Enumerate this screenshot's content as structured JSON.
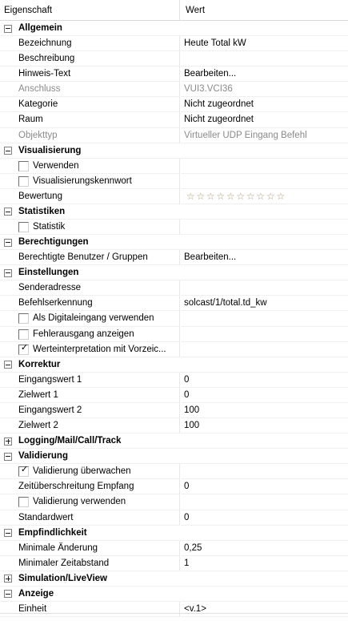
{
  "header": {
    "property": "Eigenschaft",
    "value": "Wert"
  },
  "categories": [
    {
      "label": "Allgemein",
      "expanded": true,
      "rows": [
        {
          "kind": "prop",
          "name": "Bezeichnung",
          "value": "Heute Total kW"
        },
        {
          "kind": "prop",
          "name": "Beschreibung",
          "value": ""
        },
        {
          "kind": "prop",
          "name": "Hinweis-Text",
          "value": "Bearbeiten..."
        },
        {
          "kind": "prop",
          "name": "Anschluss",
          "value": "VUI3.VCI36",
          "disabled": true
        },
        {
          "kind": "prop",
          "name": "Kategorie",
          "value": "Nicht zugeordnet"
        },
        {
          "kind": "prop",
          "name": "Raum",
          "value": "Nicht zugeordnet"
        },
        {
          "kind": "prop",
          "name": "Objekttyp",
          "value": "Virtueller UDP Eingang Befehl",
          "disabled": true
        }
      ]
    },
    {
      "label": "Visualisierung",
      "expanded": true,
      "rows": [
        {
          "kind": "check",
          "name": "Verwenden",
          "checked": false
        },
        {
          "kind": "check",
          "name": "Visualisierungskennwort",
          "checked": false
        },
        {
          "kind": "stars",
          "name": "Bewertung",
          "rating": 0,
          "max": 10,
          "icon": "star-outline-icon"
        }
      ]
    },
    {
      "label": "Statistiken",
      "expanded": true,
      "rows": [
        {
          "kind": "check",
          "name": "Statistik",
          "checked": false
        }
      ]
    },
    {
      "label": "Berechtigungen",
      "expanded": true,
      "rows": [
        {
          "kind": "prop",
          "name": "Berechtigte Benutzer / Gruppen",
          "value": "Bearbeiten..."
        }
      ]
    },
    {
      "label": "Einstellungen",
      "expanded": true,
      "rows": [
        {
          "kind": "prop",
          "name": "Senderadresse",
          "value": ""
        },
        {
          "kind": "prop",
          "name": "Befehlserkennung",
          "value": "solcast/1/total.td_kw"
        },
        {
          "kind": "check",
          "name": "Als Digitaleingang verwenden",
          "checked": false
        },
        {
          "kind": "check",
          "name": "Fehlerausgang anzeigen",
          "checked": false
        },
        {
          "kind": "check",
          "name": "Werteinterpretation mit Vorzeic...",
          "checked": true
        }
      ]
    },
    {
      "label": "Korrektur",
      "expanded": true,
      "rows": [
        {
          "kind": "prop",
          "name": "Eingangswert 1",
          "value": "0"
        },
        {
          "kind": "prop",
          "name": "Zielwert 1",
          "value": "0"
        },
        {
          "kind": "prop",
          "name": "Eingangswert 2",
          "value": "100"
        },
        {
          "kind": "prop",
          "name": "Zielwert 2",
          "value": "100"
        }
      ]
    },
    {
      "label": "Logging/Mail/Call/Track",
      "expanded": false,
      "rows": []
    },
    {
      "label": "Validierung",
      "expanded": true,
      "rows": [
        {
          "kind": "check",
          "name": "Validierung überwachen",
          "checked": true
        },
        {
          "kind": "prop",
          "name": "Zeitüberschreitung Empfang",
          "value": "0"
        },
        {
          "kind": "check",
          "name": "Validierung verwenden",
          "checked": false
        },
        {
          "kind": "prop",
          "name": "Standardwert",
          "value": "0"
        }
      ]
    },
    {
      "label": "Empfindlichkeit",
      "expanded": true,
      "rows": [
        {
          "kind": "prop",
          "name": "Minimale Änderung",
          "value": "0,25"
        },
        {
          "kind": "prop",
          "name": "Minimaler Zeitabstand",
          "value": "1"
        }
      ]
    },
    {
      "label": "Simulation/LiveView",
      "expanded": false,
      "rows": []
    },
    {
      "label": "Anzeige",
      "expanded": true,
      "rows": [
        {
          "kind": "prop",
          "name": "Einheit",
          "value": "<v.1>"
        }
      ]
    }
  ]
}
